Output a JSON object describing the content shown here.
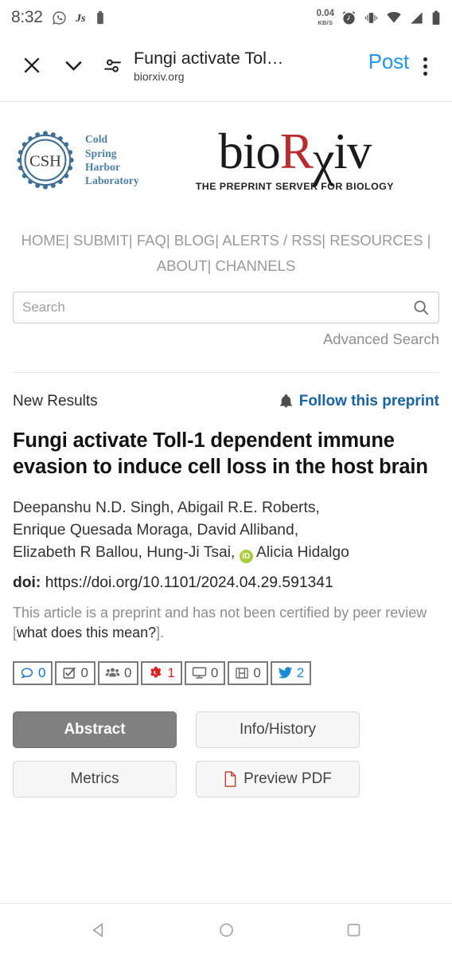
{
  "statusbar": {
    "time": "8:32",
    "icons": [
      "whatsapp-icon",
      "javascript-icon",
      "battery-saver-icon"
    ],
    "net_rate_value": "0.04",
    "net_rate_unit": "KB/S",
    "right_icons": [
      "alarm-icon",
      "vibrate-icon",
      "wifi-icon",
      "signal-icon",
      "battery-icon"
    ]
  },
  "toolbar": {
    "close_label": "×",
    "collapse_label": "chevron-down",
    "tune_label": "tune",
    "title": "Fungi activate Tol…",
    "subtitle": "biorxiv.org",
    "post_label": "Post",
    "overflow_label": "more-options"
  },
  "site": {
    "csh_lines": [
      "Cold",
      "Spring",
      "Harbor",
      "Laboratory"
    ],
    "csh_monogram": "CSH",
    "logo_part1": "bio",
    "logo_part_r": "R",
    "logo_part_x": "χ",
    "logo_part3": "iv",
    "tagline": "THE PREPRINT SERVER FOR BIOLOGY"
  },
  "nav": {
    "items_row1": [
      "HOME",
      "SUBMIT",
      "FAQ",
      "BLOG",
      "ALERTS / RSS",
      "RESOURCES"
    ],
    "items_row2": [
      "ABOUT",
      "CHANNELS"
    ],
    "separator": "|"
  },
  "search": {
    "placeholder": "Search",
    "value": "",
    "icon": "search-icon",
    "advanced_label": "Advanced Search"
  },
  "article": {
    "section_label": "New Results",
    "follow_label": "Follow this preprint",
    "title": "Fungi activate Toll-1 dependent immune evasion to induce cell loss in the host brain",
    "authors_line1": "Deepanshu N.D. Singh, Abigail R.E. Roberts,",
    "authors_line2": "Enrique Quesada Moraga, David Alliband,",
    "authors_line3_pre": "Elizabeth R Ballou, Hung-Ji Tsai,",
    "orcid_badge": "iD",
    "authors_line3_post": "Alicia Hidalgo",
    "doi_label": "doi:",
    "doi_value": "https://doi.org/10.1101/2024.04.29.591341",
    "disclaimer_pre": "This article is a preprint and has not been certified by peer review [",
    "disclaimer_link": "what does this mean?",
    "disclaimer_post": "]."
  },
  "badges": [
    {
      "name": "comments",
      "icon": "comment-bubble-icon",
      "count": "0",
      "style": "blue"
    },
    {
      "name": "reviews",
      "icon": "checkbox-checked-icon",
      "count": "0",
      "style": "gray"
    },
    {
      "name": "community",
      "icon": "people-group-icon",
      "count": "0",
      "style": "gray"
    },
    {
      "name": "citations",
      "icon": "gears-icon",
      "count": "1",
      "style": "red"
    },
    {
      "name": "blogs",
      "icon": "monitor-icon",
      "count": "0",
      "style": "gray"
    },
    {
      "name": "media",
      "icon": "film-strip-icon",
      "count": "0",
      "style": "gray"
    },
    {
      "name": "twitter",
      "icon": "twitter-bird-icon",
      "count": "2",
      "style": "tw"
    }
  ],
  "actions": {
    "abstract": "Abstract",
    "info_history": "Info/History",
    "metrics": "Metrics",
    "preview_pdf": "Preview PDF",
    "pdf_icon": "pdf-file-icon"
  },
  "navbar": {
    "back": "back-triangle-icon",
    "home": "home-circle-icon",
    "recents": "recents-square-icon"
  },
  "colors": {
    "accent_blue": "#2196F3",
    "link_blue": "#1763a8",
    "brand_red": "#BB2B2B",
    "csh_blue": "#4a7fa8",
    "orcid_green": "#A6CE39",
    "badge_red": "#e02020",
    "twitter_blue": "#1a8ad6"
  }
}
